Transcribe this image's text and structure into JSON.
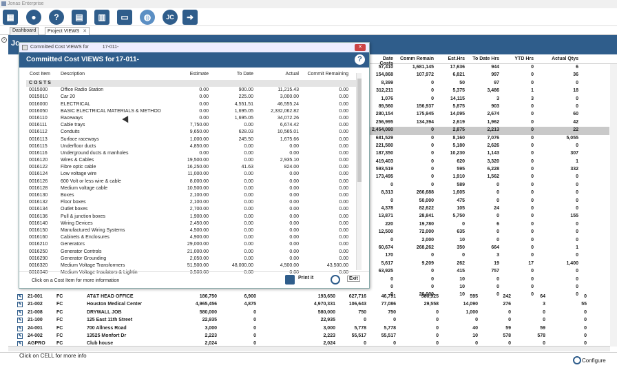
{
  "window": {
    "title": "Jonas Enterprise"
  },
  "toolbar": {
    "icons": [
      "app-logo-icon",
      "user-icon",
      "help-icon",
      "printer-icon",
      "calculator-icon",
      "inbox-icon",
      "globe-icon",
      "jc-icon",
      "exit-icon"
    ]
  },
  "tabs": [
    {
      "label": "Dashboard"
    },
    {
      "label": "Project VIEWS"
    }
  ],
  "page": {
    "title": "Jo"
  },
  "background_table": {
    "columns": [
      "Date Costs",
      "Comm Remain",
      "Est.Hrs",
      "To Date Hrs",
      "YTD Hrs",
      "Actual Qtys"
    ],
    "rows": [
      [
        "57,410",
        "1,681,145",
        "17,636",
        "944",
        "0",
        "6"
      ],
      [
        "154,868",
        "107,972",
        "6,821",
        "997",
        "0",
        "36"
      ],
      [
        "8,399",
        "0",
        "50",
        "97",
        "0",
        "0"
      ],
      [
        "312,211",
        "0",
        "5,375",
        "3,486",
        "1",
        "18"
      ],
      [
        "1,076",
        "0",
        "14,115",
        "3",
        "3",
        "0"
      ],
      [
        "89,560",
        "156,937",
        "5,875",
        "903",
        "0",
        "0"
      ],
      [
        "280,154",
        "175,945",
        "14,095",
        "2,674",
        "0",
        "60"
      ],
      [
        "256,995",
        "134,394",
        "2,619",
        "1,962",
        "0",
        "42"
      ],
      [
        "2,454,080",
        "0",
        "2,875",
        "2,213",
        "0",
        "22"
      ],
      [
        "681,529",
        "0",
        "8,160",
        "7,076",
        "0",
        "5,055"
      ],
      [
        "221,580",
        "0",
        "5,180",
        "2,626",
        "0",
        "0"
      ],
      [
        "187,350",
        "0",
        "10,230",
        "1,143",
        "0",
        "307"
      ],
      [
        "419,403",
        "0",
        "620",
        "3,320",
        "0",
        "1"
      ],
      [
        "593,519",
        "0",
        "595",
        "6,228",
        "0",
        "332"
      ],
      [
        "173,495",
        "0",
        "1,910",
        "1,562",
        "0",
        "0"
      ],
      [
        "0",
        "0",
        "589",
        "0",
        "0",
        "0"
      ],
      [
        "8,313",
        "266,688",
        "1,605",
        "0",
        "0",
        "0"
      ],
      [
        "0",
        "50,000",
        "475",
        "0",
        "0",
        "0"
      ],
      [
        "4,378",
        "82,622",
        "105",
        "24",
        "0",
        "0"
      ],
      [
        "13,871",
        "28,841",
        "5,750",
        "0",
        "0",
        "155"
      ],
      [
        "220",
        "19,780",
        "0",
        "6",
        "0",
        "0"
      ],
      [
        "12,500",
        "72,000",
        "635",
        "0",
        "0",
        "0"
      ],
      [
        "0",
        "2,000",
        "10",
        "0",
        "0",
        "0"
      ],
      [
        "60,674",
        "268,262",
        "350",
        "664",
        "0",
        "1"
      ],
      [
        "170",
        "0",
        "0",
        "3",
        "0",
        "0"
      ],
      [
        "5,617",
        "9,209",
        "262",
        "19",
        "17",
        "1,400"
      ],
      [
        "63,925",
        "0",
        "415",
        "757",
        "0",
        "0"
      ],
      [
        "0",
        "0",
        "10",
        "0",
        "0",
        "0"
      ],
      [
        "0",
        "0",
        "10",
        "0",
        "0",
        "0"
      ],
      [
        "0",
        "20,000",
        "10",
        "0",
        "0",
        "0"
      ]
    ]
  },
  "lower_rows": [
    [
      "21-001",
      "FC",
      "AT&T HEAD OFFICE",
      "186,750",
      "6,900",
      "193,650",
      "627,716",
      "46,791",
      "580,925",
      "595",
      "242",
      "64",
      "0"
    ],
    [
      "21-002",
      "FC",
      "Houston Medical Center",
      "4,965,456",
      "4,875",
      "4,970,331",
      "106,643",
      "77,086",
      "29,558",
      "14,090",
      "276",
      "3",
      "55"
    ],
    [
      "21-008",
      "FC",
      "DRYWALL JOB",
      "580,000",
      "0",
      "580,000",
      "750",
      "750",
      "0",
      "1,000",
      "0",
      "0",
      "0"
    ],
    [
      "21-100",
      "FC",
      "125 East 11th Street",
      "22,935",
      "0",
      "22,935",
      "0",
      "0",
      "0",
      "0",
      "0",
      "0",
      "0"
    ],
    [
      "24-001",
      "FC",
      "700 Allness Road",
      "3,000",
      "0",
      "3,000",
      "5,778",
      "5,778",
      "0",
      "40",
      "59",
      "59",
      "0"
    ],
    [
      "24-002",
      "FC",
      "13525 Monfort Dr",
      "2,223",
      "0",
      "2,223",
      "55,517",
      "55,517",
      "0",
      "10",
      "578",
      "578",
      "0"
    ],
    [
      "AGPRO",
      "FC",
      "Club house",
      "2,024",
      "0",
      "2,024",
      "0",
      "0",
      "0",
      "0",
      "0",
      "0",
      "0"
    ]
  ],
  "footer": {
    "message": "Click on CELL for more info",
    "configure": "Configure"
  },
  "dialog": {
    "window_title": "Committed Cost VIEWS for",
    "window_title_id": "17-011-",
    "heading": "Committed Cost VIEWS for",
    "heading_id": "17-011-",
    "columns": [
      "Cost Item",
      "Description",
      "Estimate",
      "To Date",
      "Actual",
      "Commit Remaining"
    ],
    "section": "C O S T S",
    "rows": [
      [
        "0015000",
        "Office Radio Station",
        "0.00",
        "900.00",
        "11,215.43",
        "0.00"
      ],
      [
        "0015010",
        "Car 20",
        "0.00",
        "225.00",
        "3,000.00",
        "0.00"
      ],
      [
        "0016000",
        "ELECTRICAL",
        "0.00",
        "4,551.51",
        "46,555.24",
        "0.00"
      ],
      [
        "0016050",
        "BASIC ELECTRICAL MATERIALS & METHOD",
        "0.00",
        "1,695.05",
        "2,332,062.82",
        "0.00"
      ],
      [
        "0016110",
        "Raceways",
        "0.00",
        "1,695.05",
        "34,072.26",
        "0.00"
      ],
      [
        "0016111",
        "Cable trays",
        "7,750.00",
        "0.00",
        "6,674.42",
        "0.00"
      ],
      [
        "0016112",
        "Conduits",
        "9,650.00",
        "628.03",
        "10,565.01",
        "0.00"
      ],
      [
        "0016113",
        "Surface raceways",
        "1,000.00",
        "245.50",
        "1,675.66",
        "0.00"
      ],
      [
        "0016115",
        "Underfloor ducts",
        "4,850.00",
        "0.00",
        "0.00",
        "0.00"
      ],
      [
        "0016116",
        "Underground ducts & manholes",
        "0.00",
        "0.00",
        "0.00",
        "0.00"
      ],
      [
        "0016120",
        "Wires & Cables",
        "19,500.00",
        "0.00",
        "2,935.10",
        "0.00"
      ],
      [
        "0016122",
        "Fibre optic cable",
        "16,250.00",
        "41.63",
        "824.00",
        "0.00"
      ],
      [
        "0016124",
        "Low voltage wire",
        "11,000.00",
        "0.00",
        "0.00",
        "0.00"
      ],
      [
        "0016126",
        "600 Volt or less wire & cable",
        "8,000.00",
        "0.00",
        "0.00",
        "0.00"
      ],
      [
        "0016128",
        "Medium voltage cable",
        "10,500.00",
        "0.00",
        "0.00",
        "0.00"
      ],
      [
        "0016130",
        "Boxes",
        "2,100.00",
        "0.00",
        "0.00",
        "0.00"
      ],
      [
        "0016132",
        "Floor boxes",
        "2,100.00",
        "0.00",
        "0.00",
        "0.00"
      ],
      [
        "0016134",
        "Outlet boxes",
        "2,700.00",
        "0.00",
        "0.00",
        "0.00"
      ],
      [
        "0016136",
        "Pull & junction boxes",
        "1,900.00",
        "0.00",
        "0.00",
        "0.00"
      ],
      [
        "0016140",
        "Wiring Devices",
        "2,450.00",
        "0.00",
        "0.00",
        "0.00"
      ],
      [
        "0016150",
        "Manufactured Wiring Systems",
        "4,500.00",
        "0.00",
        "0.00",
        "0.00"
      ],
      [
        "0016160",
        "Cabinets & Enclosures",
        "4,900.00",
        "0.00",
        "0.00",
        "0.00"
      ],
      [
        "0016210",
        "Generators",
        "29,000.00",
        "0.00",
        "0.00",
        "0.00"
      ],
      [
        "0016250",
        "Generator Controls",
        "21,000.00",
        "0.00",
        "0.00",
        "0.00"
      ],
      [
        "0016290",
        "Generator Grounding",
        "2,050.00",
        "0.00",
        "0.00",
        "0.00"
      ],
      [
        "0016320",
        "Medium Voltage Transformers",
        "51,500.00",
        "48,000.00",
        "4,500.00",
        "43,500.00"
      ],
      [
        "0016340",
        "Medium Voltage Insulators & Lightin",
        "3,500.00",
        "0.00",
        "0.00",
        "0.00"
      ]
    ],
    "footer_message": "Click on a Cost Item for more information",
    "print_label": "Print it",
    "exit_label": "Exit"
  }
}
